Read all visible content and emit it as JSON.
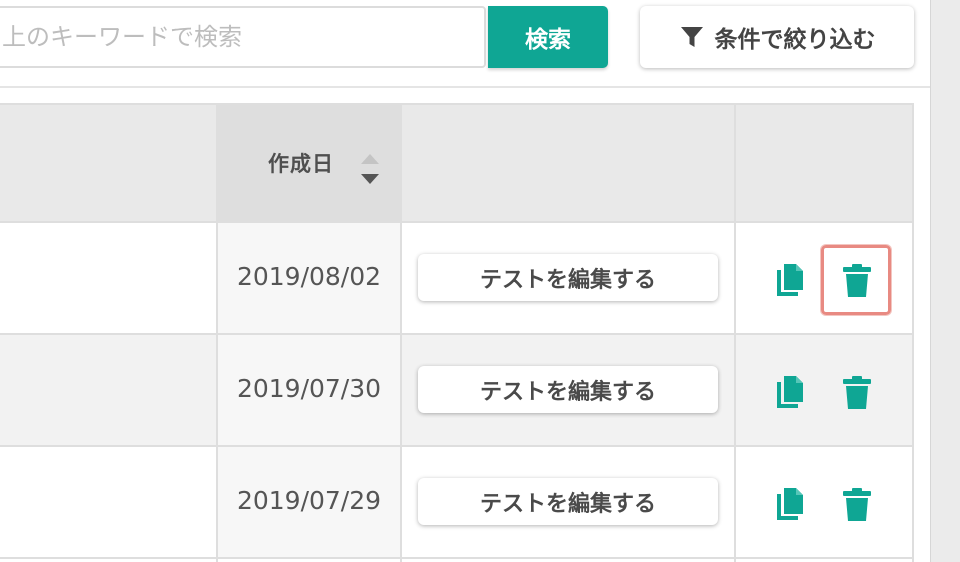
{
  "search": {
    "placeholder": "上のキーワードで検索",
    "button_label": "検索"
  },
  "filter": {
    "button_label": "条件で絞り込む",
    "icon": "filter-funnel-icon"
  },
  "table": {
    "header": {
      "created_label": "作成日",
      "sort_icon": "sort-icon"
    },
    "rows": [
      {
        "date": "2019/08/02",
        "edit_label": "テストを編集する",
        "copy_icon": "copy-icon",
        "delete_icon": "trash-icon"
      },
      {
        "date": "2019/07/30",
        "edit_label": "テストを編集する",
        "copy_icon": "copy-icon",
        "delete_icon": "trash-icon"
      },
      {
        "date": "2019/07/29",
        "edit_label": "テストを編集する",
        "copy_icon": "copy-icon",
        "delete_icon": "trash-icon"
      }
    ]
  },
  "colors": {
    "accent": "#0fa694",
    "focus_outline": "#e88a82",
    "header_bg": "#e9e9e9"
  }
}
